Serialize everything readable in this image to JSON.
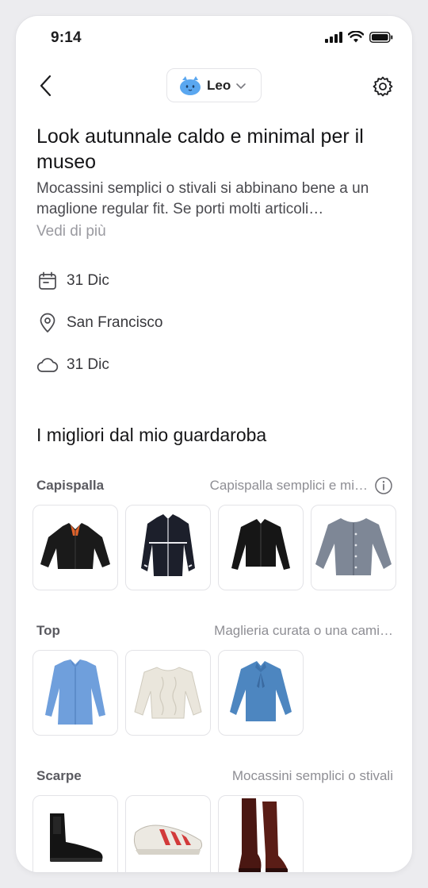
{
  "status_bar": {
    "time": "9:14"
  },
  "header": {
    "profile_name": "Leo"
  },
  "look": {
    "title": "Look autunnale caldo e minimal per il museo",
    "description": "Mocassini semplici o stivali si abbinano bene a un maglione regular fit. Se porti molti articoli…",
    "see_more": "Vedi di più",
    "date": "31 Dic",
    "location": "San Francisco",
    "weather": "31 Dic"
  },
  "wardrobe": {
    "title": "I migliori dal mio guardaroba",
    "categories": [
      {
        "name": "Capispalla",
        "description": "Capispalla semplici e mi…",
        "items": [
          "black bomber jacket",
          "navy track jacket",
          "black cropped jacket",
          "grey knit cardigan"
        ]
      },
      {
        "name": "Top",
        "description": "Maglieria curata o una cami…",
        "items": [
          "light blue oversized shirt",
          "cream cable knit sweater",
          "blue tie-neck blouse"
        ]
      },
      {
        "name": "Scarpe",
        "description": "Mocassini semplici o stivali",
        "items": [
          "black chelsea boots",
          "white red running sneakers",
          "brown knee-high boots"
        ]
      }
    ]
  },
  "colors": {
    "accent_avatar": "#5aa7f0",
    "text_primary": "#151517",
    "text_muted": "#9a9aa0"
  }
}
